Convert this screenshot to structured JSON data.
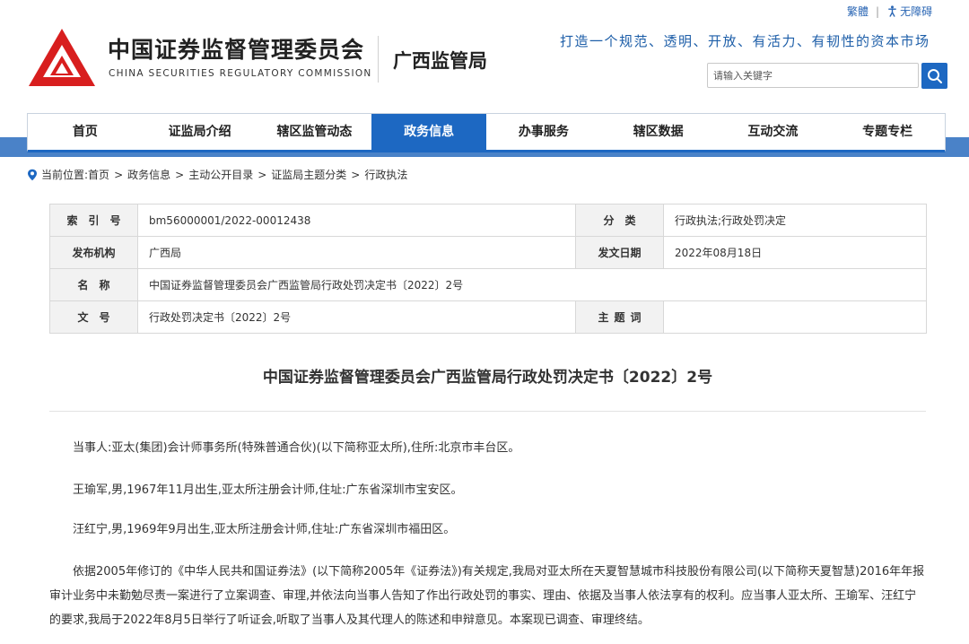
{
  "top_links": {
    "traditional": "繁體",
    "separator": "|",
    "accessibility": "无障碍"
  },
  "header": {
    "org_name_cn": "中国证券监督管理委员会",
    "org_name_en": "CHINA SECURITIES REGULATORY COMMISSION",
    "bureau": "广西监管局",
    "slogan": "打造一个规范、透明、开放、有活力、有韧性的资本市场",
    "search_placeholder": "请输入关键字"
  },
  "colors": {
    "primary": "#1d68c2",
    "logo_red": "#d81e1e",
    "band": "#4a82c8"
  },
  "nav": {
    "items": [
      {
        "label": "首页"
      },
      {
        "label": "证监局介绍"
      },
      {
        "label": "辖区监管动态"
      },
      {
        "label": "政务信息",
        "active": true
      },
      {
        "label": "办事服务"
      },
      {
        "label": "辖区数据"
      },
      {
        "label": "互动交流"
      },
      {
        "label": "专题专栏"
      }
    ]
  },
  "breadcrumb": {
    "prefix": "当前位置:",
    "items": [
      "首页",
      "政务信息",
      "主动公开目录",
      "证监局主题分类",
      "行政执法"
    ],
    "sep": ">"
  },
  "info_table": {
    "index_label": "索引号",
    "index_value": "bm56000001/2022-00012438",
    "category_label": "分类",
    "category_value": "行政执法;行政处罚决定",
    "publisher_label": "发布机构",
    "publisher_value": "广西局",
    "date_label": "发文日期",
    "date_value": "2022年08月18日",
    "name_label": "名称",
    "name_value": "中国证券监督管理委员会广西监管局行政处罚决定书〔2022〕2号",
    "docno_label": "文号",
    "docno_value": "行政处罚决定书〔2022〕2号",
    "keyword_label": "主题词",
    "keyword_value": ""
  },
  "article": {
    "title": "中国证券监督管理委员会广西监管局行政处罚决定书〔2022〕2号",
    "paragraphs": [
      "当事人:亚太(集团)会计师事务所(特殊普通合伙)(以下简称亚太所),住所:北京市丰台区。",
      "王瑜军,男,1967年11月出生,亚太所注册会计师,住址:广东省深圳市宝安区。",
      "汪红宁,男,1969年9月出生,亚太所注册会计师,住址:广东省深圳市福田区。",
      "依据2005年修订的《中华人民共和国证券法》(以下简称2005年《证券法》)有关规定,我局对亚太所在天夏智慧城市科技股份有限公司(以下简称天夏智慧)2016年年报审计业务中未勤勉尽责一案进行了立案调查、审理,并依法向当事人告知了作出行政处罚的事实、理由、依据及当事人依法享有的权利。应当事人亚太所、王瑜军、汪红宁的要求,我局于2022年8月5日举行了听证会,听取了当事人及其代理人的陈述和申辩意见。本案现已调查、审理终结。"
    ]
  }
}
